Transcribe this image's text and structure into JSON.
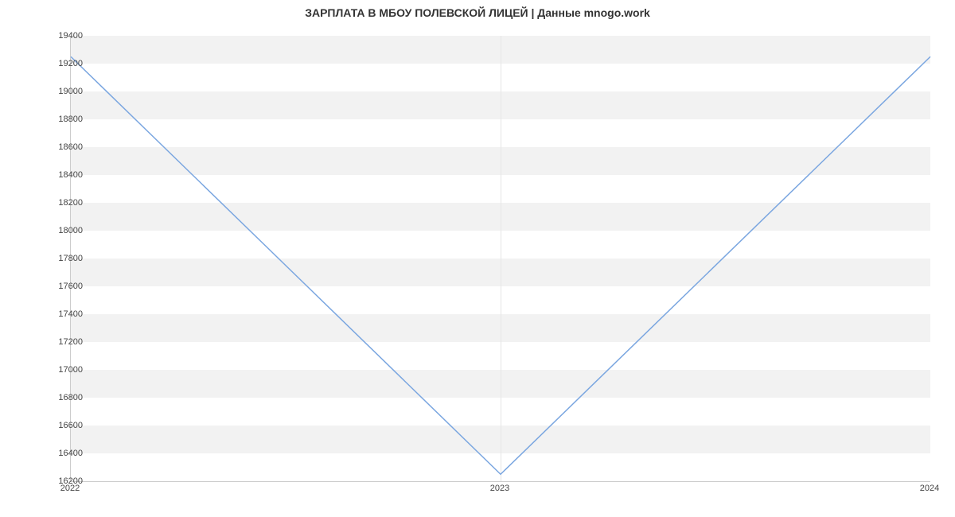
{
  "chart_data": {
    "type": "line",
    "title": "ЗАРПЛАТА В МБОУ ПОЛЕВСКОЙ ЛИЦЕЙ | Данные mnogo.work",
    "x": [
      2022,
      2023,
      2024
    ],
    "values": [
      19250,
      16250,
      19250
    ],
    "xlim": [
      2022,
      2024
    ],
    "ylim": [
      16200,
      19400
    ],
    "y_ticks": [
      16200,
      16400,
      16600,
      16800,
      17000,
      17200,
      17400,
      17600,
      17800,
      18000,
      18200,
      18400,
      18600,
      18800,
      19000,
      19200,
      19400
    ],
    "x_ticks": [
      2022,
      2023,
      2024
    ],
    "line_color": "#7aa6e0",
    "band_color": "#f2f2f2"
  }
}
